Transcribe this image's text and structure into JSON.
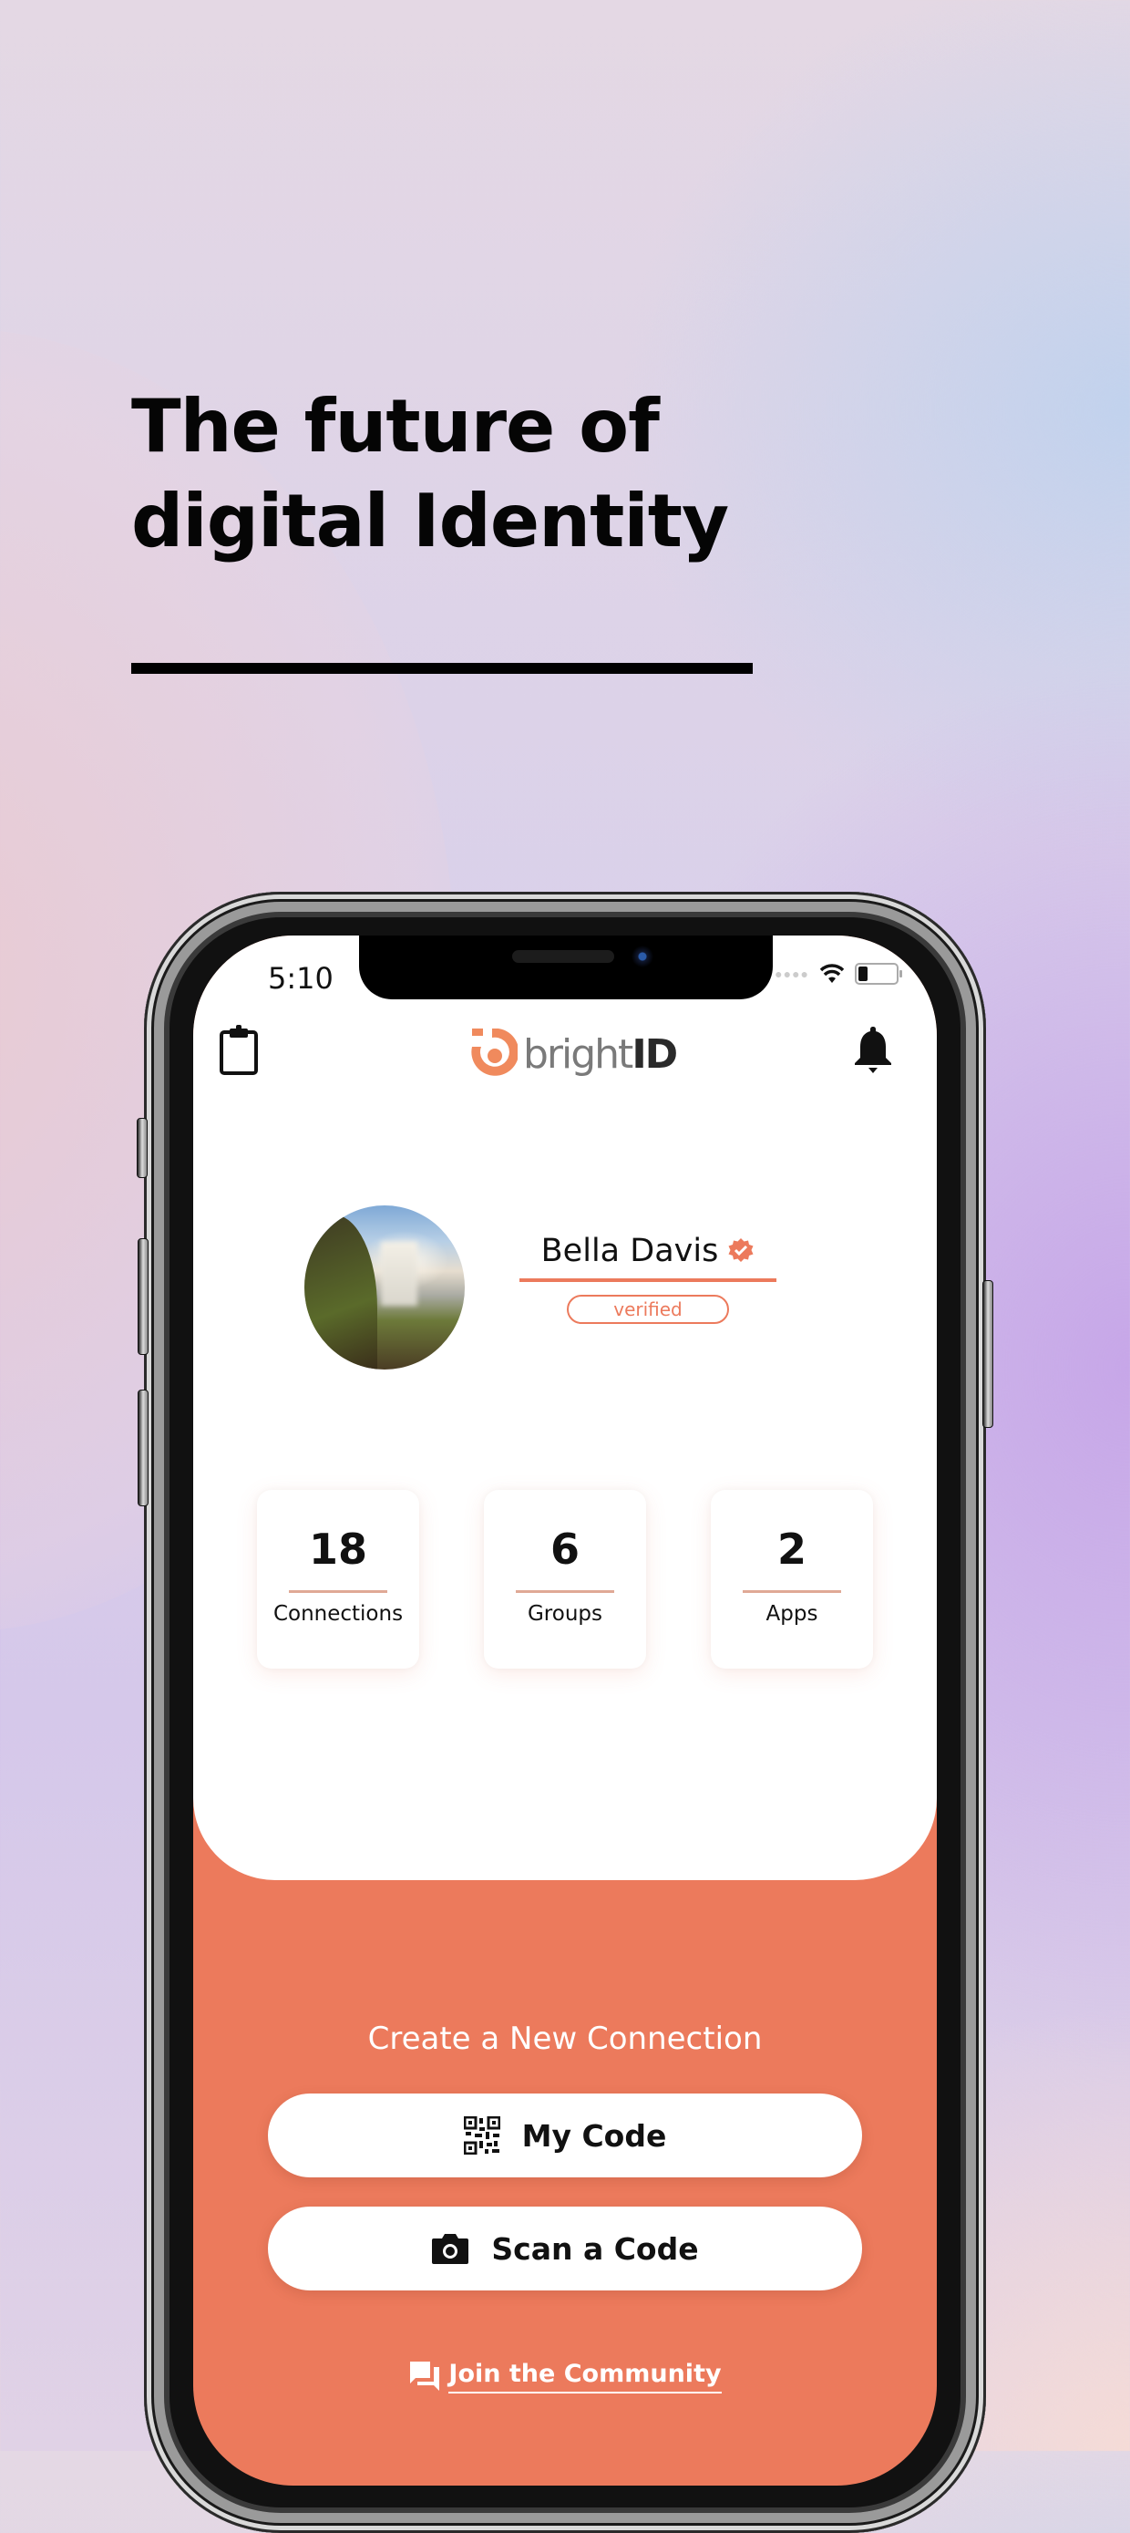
{
  "hero": {
    "headline_line1": "The future of",
    "headline_line2": "digital Identity"
  },
  "status_bar": {
    "time": "5:10",
    "icons": [
      "signal-dots-icon",
      "wifi-icon",
      "battery-icon"
    ]
  },
  "app_bar": {
    "left_icon": "clipboard-icon",
    "logo_text": "bright",
    "logo_text_bold": "ID",
    "right_icon": "bell-icon"
  },
  "profile": {
    "name": "Bella Davis",
    "verified_icon": "verified-badge-icon",
    "status_label": "verified",
    "avatar": "waterfall landscape photo"
  },
  "stats": [
    {
      "value": "18",
      "label": "Connections"
    },
    {
      "value": "6",
      "label": "Groups"
    },
    {
      "value": "2",
      "label": "Apps"
    }
  ],
  "connection": {
    "title": "Create a New Connection",
    "buttons": [
      {
        "label": "My Code",
        "icon": "qr-code-icon"
      },
      {
        "label": "Scan a Code",
        "icon": "camera-icon"
      }
    ],
    "community_link": {
      "label": "Join the Community",
      "icon": "chat-bubbles-icon"
    }
  },
  "colors": {
    "accent": "#ec7a5c",
    "stat_rule": "#e0a996",
    "text": "#111111",
    "card": "#ffffff"
  }
}
